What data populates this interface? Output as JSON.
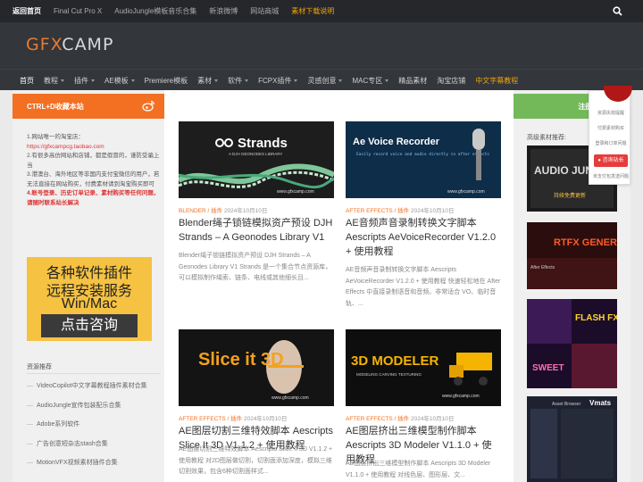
{
  "topbar": {
    "links": [
      {
        "label": "返回首页",
        "style": "strong"
      },
      {
        "label": "Final Cut Pro X",
        "style": "normal"
      },
      {
        "label": "AudioJungle模板音乐合集",
        "style": "normal"
      },
      {
        "label": "新浪微博",
        "style": "normal"
      },
      {
        "label": "网站商城",
        "style": "normal"
      },
      {
        "label": "素材下载说明",
        "style": "accent"
      }
    ],
    "search_icon": "search-icon"
  },
  "header": {
    "logo_part1": "GFX",
    "logo_part2": "CAMP"
  },
  "nav": {
    "items": [
      {
        "label": "首页",
        "dropdown": false,
        "style": "active"
      },
      {
        "label": "教程",
        "dropdown": true,
        "style": "normal"
      },
      {
        "label": "插件",
        "dropdown": true,
        "style": "normal"
      },
      {
        "label": "AE模板",
        "dropdown": true,
        "style": "normal"
      },
      {
        "label": "Premiere模板",
        "dropdown": false,
        "style": "normal"
      },
      {
        "label": "素材",
        "dropdown": true,
        "style": "normal"
      },
      {
        "label": "软件",
        "dropdown": true,
        "style": "normal"
      },
      {
        "label": "FCPX插件",
        "dropdown": true,
        "style": "normal"
      },
      {
        "label": "灵感创意",
        "dropdown": true,
        "style": "normal"
      },
      {
        "label": "MAC专区",
        "dropdown": true,
        "style": "normal"
      },
      {
        "label": "精品素材",
        "dropdown": false,
        "style": "normal"
      },
      {
        "label": "淘宝店铺",
        "dropdown": false,
        "style": "normal"
      },
      {
        "label": "中文字幕教程",
        "dropdown": false,
        "style": "hot"
      }
    ]
  },
  "left_sidebar": {
    "header": "CTRL+D收藏本站",
    "notice": {
      "line1": "1.网站唯一的淘宝店：",
      "link": "https://gfxcampcg.taobao.com",
      "line2": "2.有很多高仿网站和店铺，都是假冒的，谨防受骗上当",
      "line3": "3.港澳台、海外地区等非国内支付宝微信的用户，若无法直接在网站购买，付费素材请到淘宝购买即可",
      "line4": "4.账号登录、历史订单记录、素材购买等任何问题，请随时联系站长解决"
    },
    "ad": {
      "line1": "各种软件插件",
      "line2": "远程安装服务",
      "line3": "Win/Mac",
      "button": "点击咨询"
    },
    "resources_title": "资源推荐",
    "resources": [
      "VideoCopilot中文字幕教程插件素材合集",
      "AudioJungle宣传包装配乐合集",
      "Adobe系列软件",
      "广告创意短杂志stash合集",
      "MotionVFX视频素材插件合集"
    ]
  },
  "posts": [
    {
      "image_text": "Strands",
      "image_subtext": "A DJH GEONODES LIBRARY",
      "watermark": "www.gfxcamp.com",
      "category1": "BLENDER",
      "category2": "插件",
      "date": "2024年10月10日",
      "title": "Blender绳子锁链模拟资产预设 DJH Strands – A Geonodes Library V1",
      "excerpt": "Blender绳子锁链模拟资产预设 DJH Strands – A Geonodes Library V1 Strands 是一个集合节点资源库，可以模拟制作绳索、链条、电线或其他细长且..."
    },
    {
      "image_text": "Ae Voice Recorder",
      "image_subtext": "Easily record voice and audio directly in after effects",
      "watermark": "www.gfxcamp.com",
      "category1": "AFTER EFFECTS",
      "category2": "插件",
      "date": "2024年10月10日",
      "title": "AE音频声音录制转换文字脚本 Aescripts AeVoiceRecorder V1.2.0 + 使用教程",
      "excerpt": "AE音频声音录制转换文字脚本 Aescripts AeVoiceRecorder V1.2.0 + 使用教程 快速轻松地在 After Effects 中直接录制语音和音频。非常适合 VO、临时音轨、..."
    },
    {
      "image_text": "Slice it 3D",
      "image_subtext": "",
      "watermark": "www.gfxcamp.com",
      "category1": "AFTER EFFECTS",
      "category2": "插件",
      "date": "2024年10月10日",
      "title": "AE图层切割三维特效脚本 Aescripts Slice It 3D V1.1.2 + 使用教程",
      "excerpt": "AE图层切割三维特效脚本 Aescripts Slice It 3D V1.1.2 + 使用教程 对2D图层做切割，切割面添加深度，模拟三维切割效果，包含6种切割面样式..."
    },
    {
      "image_text": "3D MODELER",
      "image_subtext": "MODELING  CARVING  TEXTURING",
      "watermark": "www.gfxcamp.com",
      "category1": "AFTER EFFECTS",
      "category2": "插件",
      "date": "2024年10月10日",
      "title": "AE图层挤出三维模型制作脚本 Aescripts 3D Modeler V1.1.0 + 使用教程",
      "excerpt": "AE图层挤出三维模型制作脚本 Aescripts 3D Modeler V1.1.0 + 使用教程 对线色层、图形层、文..."
    }
  ],
  "right_sidebar": {
    "header": "注册 | 登录",
    "rec_title": "高级素材推荐:",
    "rec_images": [
      {
        "text": "AUDIO JUNGLE",
        "sub": "持续免费更新"
      },
      {
        "text": "RTFX GENERATOR",
        "sub": "After Effects"
      },
      {
        "text": "FLASH FX PRO",
        "sub": "SWEET"
      },
      {
        "text": "Vmats",
        "sub": "Asset Browser"
      }
    ]
  },
  "support_panel": {
    "items": [
      "资源失效提醒",
      "付费素材购买",
      "登录和订单问题",
      "未支付包发送问题"
    ],
    "consult": "咨询站长"
  }
}
